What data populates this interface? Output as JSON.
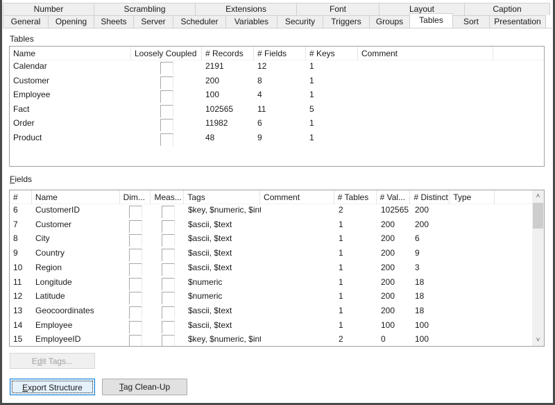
{
  "tabs": {
    "row1": [
      {
        "label": "Number"
      },
      {
        "label": "Scrambling"
      },
      {
        "label": "Extensions"
      },
      {
        "label": "Font"
      },
      {
        "label": "Layout"
      },
      {
        "label": "Caption"
      }
    ],
    "row2": [
      {
        "label": "General"
      },
      {
        "label": "Opening"
      },
      {
        "label": "Sheets"
      },
      {
        "label": "Server"
      },
      {
        "label": "Scheduler"
      },
      {
        "label": "Variables"
      },
      {
        "label": "Security"
      },
      {
        "label": "Triggers"
      },
      {
        "label": "Groups"
      },
      {
        "label": "Tables",
        "active": true
      },
      {
        "label": "Sort"
      },
      {
        "label": "Presentation"
      }
    ]
  },
  "tables_section": {
    "label": "Tables",
    "columns": [
      "Name",
      "Loosely Coupled",
      "# Records",
      "# Fields",
      "# Keys",
      "Comment"
    ],
    "rows": [
      {
        "name": "Calendar",
        "loosely_coupled": false,
        "records": "2191",
        "fields": "12",
        "keys": "1",
        "comment": ""
      },
      {
        "name": "Customer",
        "loosely_coupled": false,
        "records": "200",
        "fields": "8",
        "keys": "1",
        "comment": ""
      },
      {
        "name": "Employee",
        "loosely_coupled": false,
        "records": "100",
        "fields": "4",
        "keys": "1",
        "comment": ""
      },
      {
        "name": "Fact",
        "loosely_coupled": false,
        "records": "102565",
        "fields": "11",
        "keys": "5",
        "comment": ""
      },
      {
        "name": "Order",
        "loosely_coupled": false,
        "records": "11982",
        "fields": "6",
        "keys": "1",
        "comment": ""
      },
      {
        "name": "Product",
        "loosely_coupled": false,
        "records": "48",
        "fields": "9",
        "keys": "1",
        "comment": ""
      }
    ]
  },
  "fields_section": {
    "label_accel": "F",
    "label_rest": "ields",
    "columns": [
      "#",
      "Name",
      "Dim...",
      "Meas...",
      "Tags",
      "Comment",
      "# Tables",
      "# Val...",
      "# Distinct",
      "Type"
    ],
    "rows": [
      {
        "num": "6",
        "name": "CustomerID",
        "dim": false,
        "meas": false,
        "tags": "$key, $numeric, $int",
        "comment": "",
        "tables": "2",
        "values": "102565",
        "distinct": "200",
        "type": ""
      },
      {
        "num": "7",
        "name": "Customer",
        "dim": false,
        "meas": false,
        "tags": "$ascii, $text",
        "comment": "",
        "tables": "1",
        "values": "200",
        "distinct": "200",
        "type": ""
      },
      {
        "num": "8",
        "name": "City",
        "dim": false,
        "meas": false,
        "tags": "$ascii, $text",
        "comment": "",
        "tables": "1",
        "values": "200",
        "distinct": "6",
        "type": ""
      },
      {
        "num": "9",
        "name": "Country",
        "dim": false,
        "meas": false,
        "tags": "$ascii, $text",
        "comment": "",
        "tables": "1",
        "values": "200",
        "distinct": "9",
        "type": ""
      },
      {
        "num": "10",
        "name": "Region",
        "dim": false,
        "meas": false,
        "tags": "$ascii, $text",
        "comment": "",
        "tables": "1",
        "values": "200",
        "distinct": "3",
        "type": ""
      },
      {
        "num": "11",
        "name": "Longitude",
        "dim": false,
        "meas": false,
        "tags": "$numeric",
        "comment": "",
        "tables": "1",
        "values": "200",
        "distinct": "18",
        "type": ""
      },
      {
        "num": "12",
        "name": "Latitude",
        "dim": false,
        "meas": false,
        "tags": "$numeric",
        "comment": "",
        "tables": "1",
        "values": "200",
        "distinct": "18",
        "type": ""
      },
      {
        "num": "13",
        "name": "Geocoordinates",
        "dim": false,
        "meas": false,
        "tags": "$ascii, $text",
        "comment": "",
        "tables": "1",
        "values": "200",
        "distinct": "18",
        "type": ""
      },
      {
        "num": "14",
        "name": "Employee",
        "dim": false,
        "meas": false,
        "tags": "$ascii, $text",
        "comment": "",
        "tables": "1",
        "values": "100",
        "distinct": "100",
        "type": ""
      },
      {
        "num": "15",
        "name": "EmployeeID",
        "dim": false,
        "meas": false,
        "tags": "$key, $numeric, $int",
        "comment": "",
        "tables": "2",
        "values": "0",
        "distinct": "100",
        "type": ""
      }
    ],
    "scroll_icons": {
      "up": "chevron-up-icon",
      "down": "chevron-down-icon"
    }
  },
  "buttons": {
    "edit_tags": {
      "pre": "E",
      "accel": "d",
      "post": "it Tags...",
      "enabled": false
    },
    "export_structure": {
      "pre": "",
      "accel": "E",
      "post": "xport Structure",
      "enabled": true,
      "focused": true
    },
    "tag_cleanup": {
      "pre": "",
      "accel": "T",
      "post": "ag Clean-Up",
      "enabled": true
    }
  }
}
